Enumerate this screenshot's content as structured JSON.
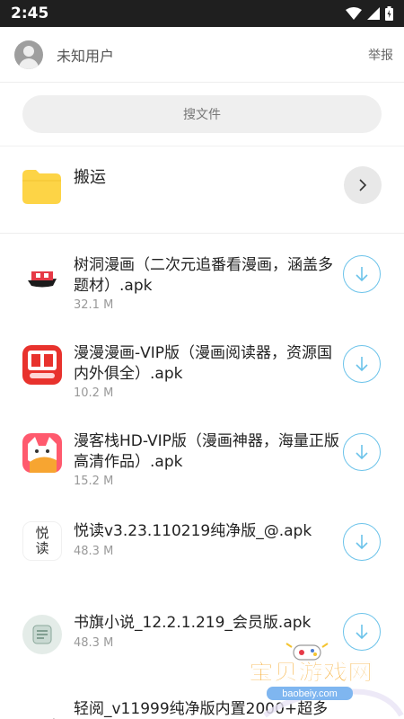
{
  "status_bar": {
    "time": "2:45"
  },
  "header": {
    "username": "未知用户",
    "report_label": "举报"
  },
  "search": {
    "placeholder": "搜文件"
  },
  "folder": {
    "name": "搬运"
  },
  "files": [
    {
      "name": "树洞漫画（二次元追番看漫画，涵盖多题材）.apk",
      "size": "32.1 M",
      "icon": "shudong-app-icon"
    },
    {
      "name": "漫漫漫画-VIP版（漫画阅读器，资源国内外俱全）.apk",
      "size": "10.2 M",
      "icon": "manman-app-icon"
    },
    {
      "name": "漫客栈HD-VIP版（漫画神器，海量正版高清作品）.apk",
      "size": "15.2 M",
      "icon": "mankezhan-app-icon"
    },
    {
      "name": "悦读v3.23.110219纯净版_@.apk",
      "size": "48.3 M",
      "icon": "yuedu-app-icon",
      "icon_text": "悦读"
    },
    {
      "name": "书旗小说_12.2.1.219_会员版.apk",
      "size": "48.3 M",
      "icon": "shuqi-app-icon"
    },
    {
      "name": "轻阅_v11999纯净版内置2000+超多",
      "size": "",
      "icon": "qingyue-app-icon"
    }
  ],
  "watermark": {
    "brand": "宝贝游戏网",
    "domain": "baobeiy.com"
  },
  "colors": {
    "accent": "#6cc3ea",
    "folder": "#fdd446",
    "status_bar": "#1f1f1f"
  }
}
